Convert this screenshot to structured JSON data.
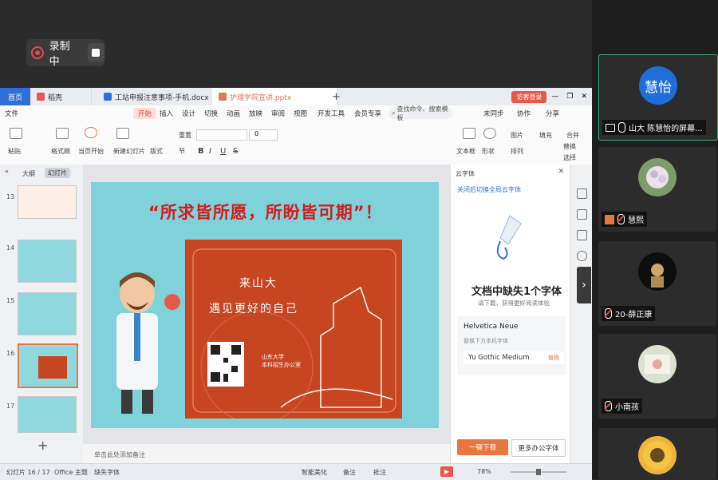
{
  "recording": {
    "label": "录制中"
  },
  "wps": {
    "tabs": [
      {
        "label": "首页"
      },
      {
        "label": "稻壳"
      },
      {
        "label": "工站申报注意事项-手机.docx"
      },
      {
        "label": "护理学院宣讲.pptx"
      }
    ],
    "login_label": "访客登录",
    "menu": [
      "文件",
      "开始",
      "插入",
      "设计",
      "切换",
      "动画",
      "放映",
      "审阅",
      "视图",
      "开发工具",
      "会员专享"
    ],
    "search_placeholder": "查找命令、搜索模板",
    "menu_right": [
      "未同步",
      "协作",
      "分享"
    ],
    "ribbon": {
      "paste": "粘贴",
      "format_painter": "格式刷",
      "start_show": "当页开始",
      "new_slide": "新建幻灯片",
      "layout": "版式",
      "section": "节",
      "reset": "重置",
      "font_size": "0",
      "textbox": "文本框",
      "shape": "形状",
      "arrange": "排列",
      "picture": "图片",
      "replace": "替换",
      "fill": "填充",
      "merge": "合并",
      "select": "选择"
    },
    "left_panel": {
      "tab_outline": "大纲",
      "tab_slides": "幻灯片",
      "thumb_numbers": [
        "13",
        "14",
        "15",
        "16",
        "17"
      ]
    },
    "slide": {
      "title": "“所求皆所愿，所盼皆可期”！",
      "poster_line1": "来山大",
      "poster_line2": "遇见更好的自己",
      "org_line1": "山东大学",
      "org_line2": "本科招生办公室"
    },
    "notes_placeholder": "单击此处添加备注",
    "font_pane": {
      "title": "云字体",
      "link": "关闭后切换全局云字体",
      "heading": "文档中缺失1个字体",
      "sub": "请下载，获得更好阅读体验",
      "missing_font": "Helvetica Neue",
      "replace_hint": "替换下方本机字体",
      "replacement": "Yu Gothic Medium",
      "replace_action": "替换",
      "download_btn": "一键下载",
      "more_btn": "更多办公字体"
    },
    "statusbar": {
      "slide_count": "幻灯片 16 / 17",
      "theme": "Office 主题",
      "missing_font": "缺失字体",
      "smart_beautify": "智能美化",
      "notes": "备注",
      "comments": "批注",
      "zoom": "78%"
    }
  },
  "participants": [
    {
      "name": "山大 陈慧怡的屏幕...",
      "avatar_text": "慧怡",
      "avatar_color": "#1e6fd9",
      "sharing": true
    },
    {
      "name": "慧熙",
      "muted": true
    },
    {
      "name": "20-薛正康",
      "muted": true
    },
    {
      "name": "小南孩",
      "muted": true
    }
  ]
}
